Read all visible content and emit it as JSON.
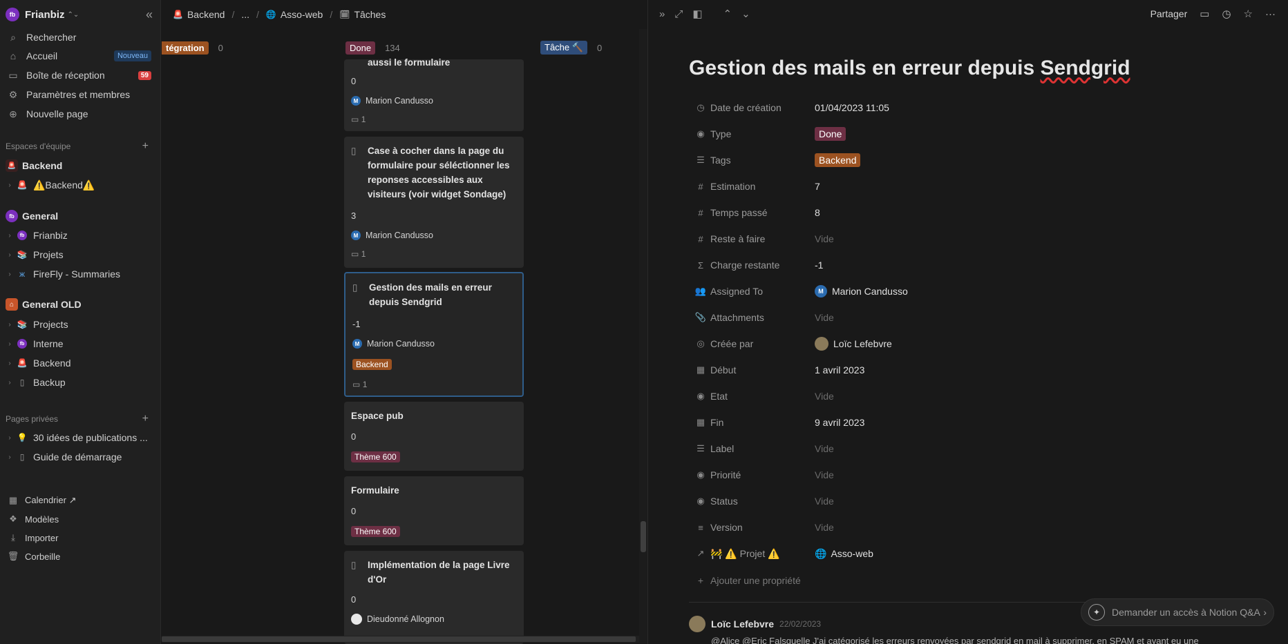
{
  "sidebar": {
    "workspace": {
      "avatar": "fb",
      "name": "Frianbiz"
    },
    "nav": [
      {
        "icon": "search-icon",
        "glyph": "⌕",
        "label": "Rechercher"
      },
      {
        "icon": "home-icon",
        "glyph": "⌂",
        "label": "Accueil",
        "badge": "Nouveau"
      },
      {
        "icon": "inbox-icon",
        "glyph": "▭",
        "label": "Boîte de réception",
        "count": "59"
      },
      {
        "icon": "settings-icon",
        "glyph": "⚙",
        "label": "Paramètres et membres"
      },
      {
        "icon": "new-page-icon",
        "glyph": "⊕",
        "label": "Nouvelle page"
      }
    ],
    "team_section": "Espaces d'équipe",
    "team_items": [
      {
        "label": "Backend",
        "type": "team"
      },
      {
        "label": "⚠️Backend⚠️",
        "type": "page"
      },
      {
        "label": "General",
        "type": "team"
      },
      {
        "label": "Frianbiz",
        "type": "page"
      },
      {
        "label": "Projets",
        "type": "page"
      },
      {
        "label": "FireFly - Summaries",
        "type": "page"
      },
      {
        "label": "General OLD",
        "type": "team"
      },
      {
        "label": "Projects",
        "type": "page"
      },
      {
        "label": "Interne",
        "type": "page"
      },
      {
        "label": "Backend",
        "type": "page"
      },
      {
        "label": "Backup",
        "type": "page"
      }
    ],
    "private_section": "Pages privées",
    "private_items": [
      {
        "label": "30 idées de publications ..."
      },
      {
        "label": "Guide de démarrage"
      }
    ],
    "footer": [
      {
        "icon": "calendar-icon",
        "label": "Calendrier ↗"
      },
      {
        "icon": "templates-icon",
        "label": "Modèles"
      },
      {
        "icon": "import-icon",
        "label": "Importer"
      },
      {
        "icon": "trash-icon",
        "label": "Corbeille"
      }
    ]
  },
  "breadcrumb": [
    "Backend",
    "...",
    "Asso-web",
    "Tâches"
  ],
  "board": {
    "columns": [
      {
        "label": "tégration",
        "count": "0",
        "color": "#9c5221"
      },
      {
        "label": "Done",
        "count": "134",
        "color": "#6d2f44"
      },
      {
        "label": "Tâche 🔨",
        "count": "0",
        "color": "#2f4d7a"
      }
    ],
    "cards": [
      {
        "title": "aussi le formulaire",
        "num": "0",
        "person": "Marion Candusso",
        "comments": "1"
      },
      {
        "title": "Case à cocher dans la page du formulaire pour séléctionner les reponses accessibles aux visiteurs (voir widget Sondage)",
        "num": "3",
        "person": "Marion Candusso",
        "comments": "1"
      },
      {
        "title": "Gestion des mails en erreur depuis Sendgrid",
        "num": "-1",
        "person": "Marion Candusso",
        "tag": "Backend",
        "comments": "1"
      },
      {
        "title": "Espace pub",
        "num": "0",
        "tag": "Thème 600"
      },
      {
        "title": "Formulaire",
        "num": "0",
        "tag": "Thème 600"
      },
      {
        "title": "Implémentation de la page Livre d'Or",
        "num": "0",
        "person": "Dieudonné Allognon"
      }
    ]
  },
  "peek": {
    "share": "Partager",
    "title_prefix": "Gestion des mails en erreur depuis ",
    "title_word": "Sendgrid",
    "properties": [
      {
        "icon": "clock-icon",
        "glyph": "◷",
        "name": "Date de création",
        "value": "01/04/2023 11:05"
      },
      {
        "icon": "select-icon",
        "glyph": "◉",
        "name": "Type",
        "value": "Done",
        "pill": "done"
      },
      {
        "icon": "list-icon",
        "glyph": "☰",
        "name": "Tags",
        "value": "Backend",
        "pill": "backend"
      },
      {
        "icon": "number-icon",
        "glyph": "#",
        "name": "Estimation",
        "value": "7"
      },
      {
        "icon": "number-icon",
        "glyph": "#",
        "name": "Temps passé",
        "value": "8"
      },
      {
        "icon": "number-icon",
        "glyph": "#",
        "name": "Reste à faire",
        "value": "Vide",
        "empty": true
      },
      {
        "icon": "formula-icon",
        "glyph": "Σ",
        "name": "Charge restante",
        "value": "-1"
      },
      {
        "icon": "people-icon",
        "glyph": "👥",
        "name": "Assigned To",
        "value": "Marion Candusso",
        "avatar": "M"
      },
      {
        "icon": "paperclip-icon",
        "glyph": "📎",
        "name": "Attachments",
        "value": "Vide",
        "empty": true
      },
      {
        "icon": "created-by-icon",
        "glyph": "◎",
        "name": "Créée par",
        "value": "Loïc Lefebvre",
        "photo": true
      },
      {
        "icon": "calendar-icon",
        "glyph": "▦",
        "name": "Début",
        "value": "1 avril 2023"
      },
      {
        "icon": "select-icon",
        "glyph": "◉",
        "name": "Etat",
        "value": "Vide",
        "empty": true
      },
      {
        "icon": "calendar-icon",
        "glyph": "▦",
        "name": "Fin",
        "value": "9 avril 2023"
      },
      {
        "icon": "list-icon",
        "glyph": "☰",
        "name": "Label",
        "value": "Vide",
        "empty": true
      },
      {
        "icon": "select-icon",
        "glyph": "◉",
        "name": "Priorité",
        "value": "Vide",
        "empty": true
      },
      {
        "icon": "select-icon",
        "glyph": "◉",
        "name": "Status",
        "value": "Vide",
        "empty": true
      },
      {
        "icon": "text-icon",
        "glyph": "≡",
        "name": "Version",
        "value": "Vide",
        "empty": true
      },
      {
        "icon": "relation-icon",
        "glyph": "↗",
        "name": "🚧 ⚠️ Projet ⚠️",
        "value": "Asso-web",
        "globe": true
      }
    ],
    "add_property": "Ajouter une propriété",
    "comment": {
      "author": "Loïc Lefebvre",
      "date": "22/02/2023",
      "text": "@Alice @Eric Falsquelle J'ai catégorisé les erreurs renvoyées par sendgrid en mail à supprimer, en SPAM et ayant eu une"
    },
    "qa_label": "Demander un accès à Notion Q&A"
  }
}
